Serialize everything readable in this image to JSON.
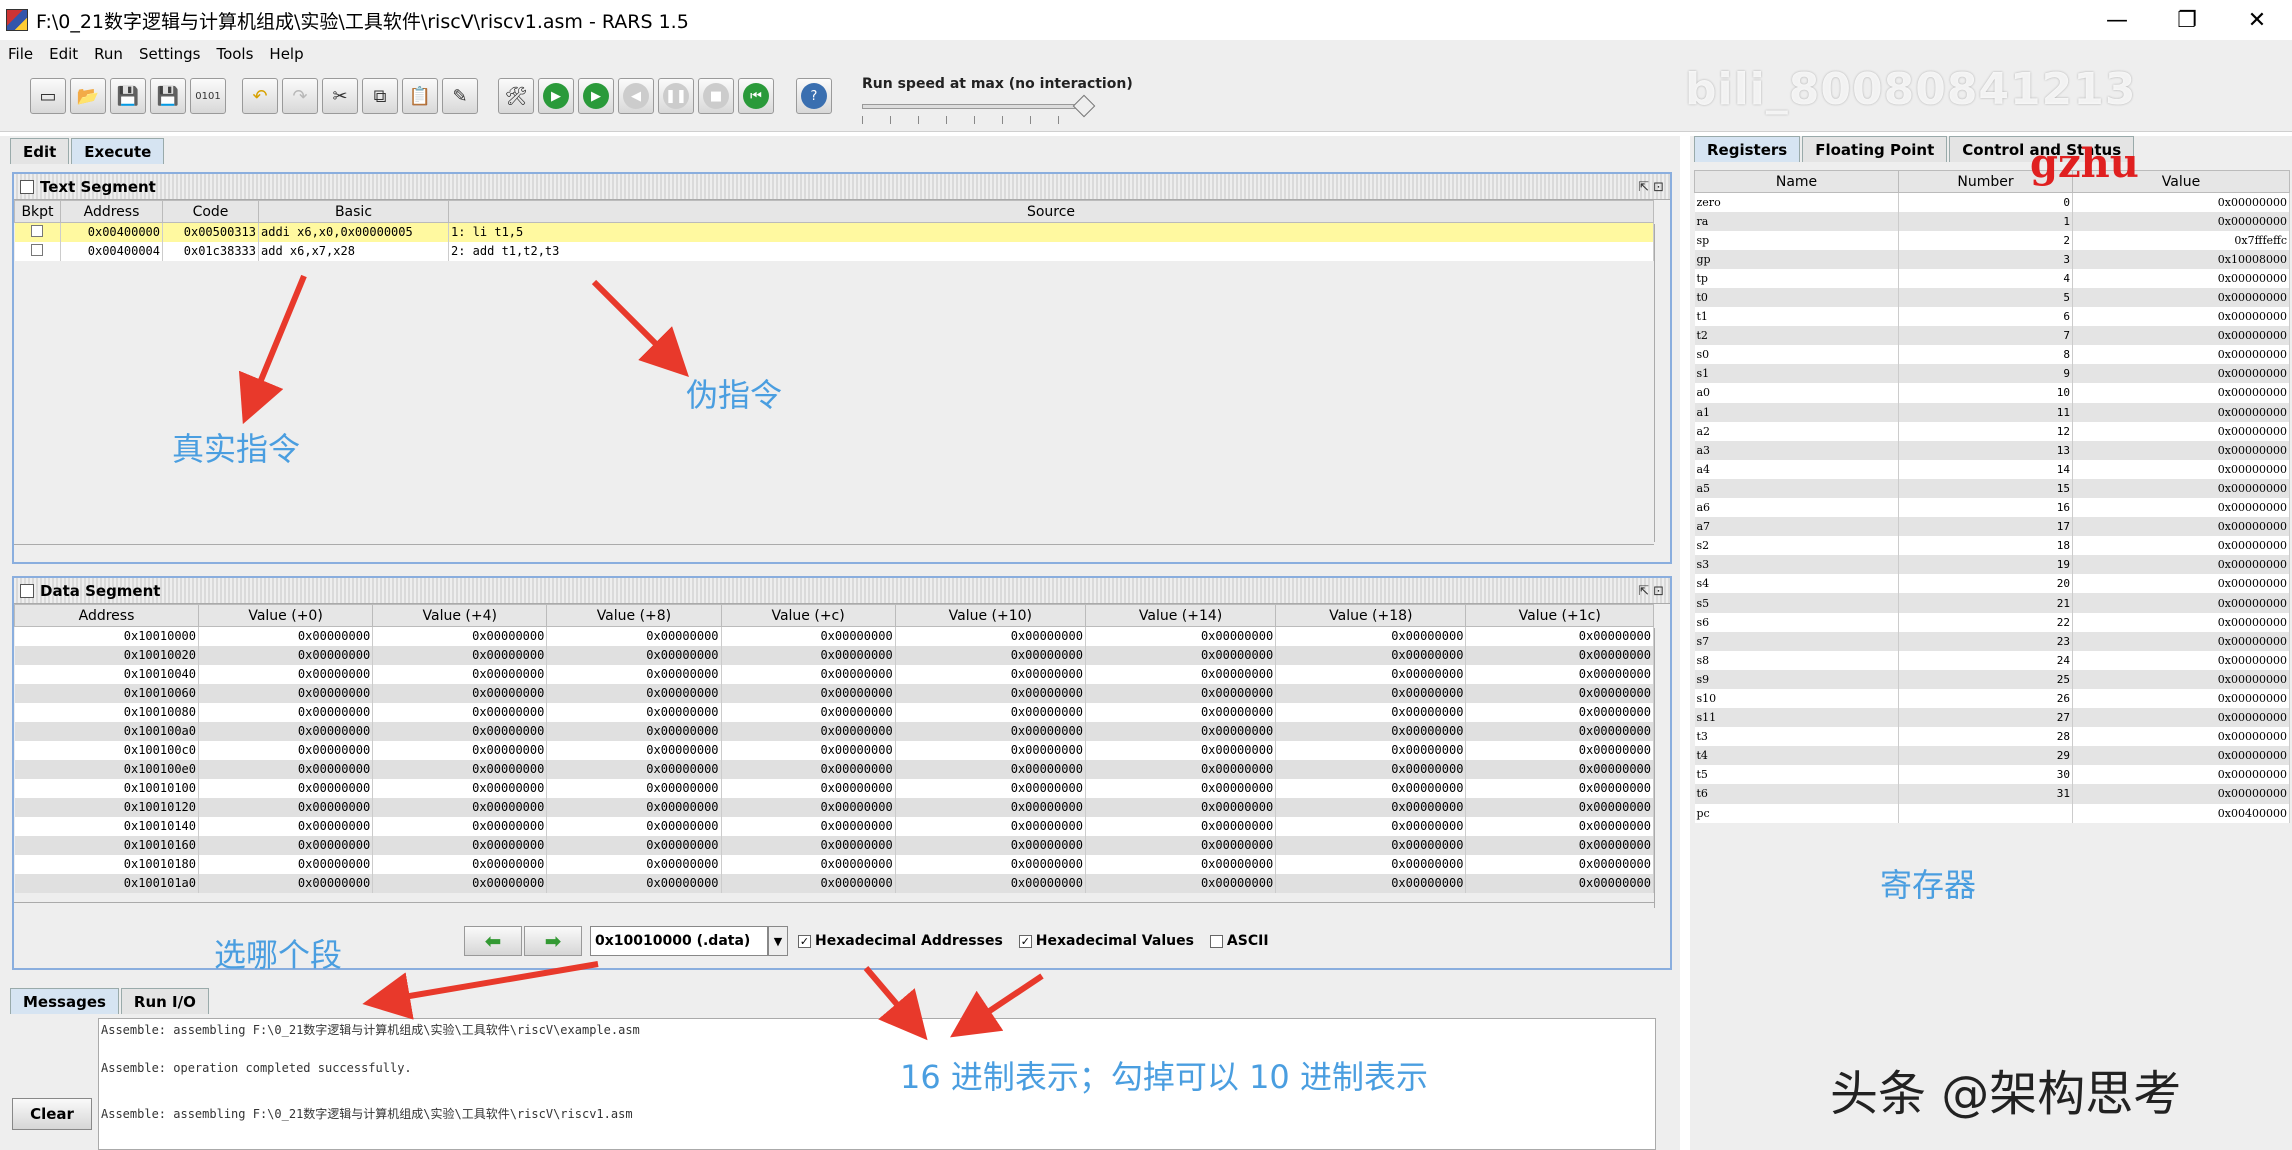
{
  "window": {
    "title": "F:\\0_21数字逻辑与计算机组成\\实验\\工具软件\\riscV\\riscv1.asm  - RARS 1.5",
    "minimize": "—",
    "maximize": "❐",
    "close": "✕"
  },
  "menu": [
    "File",
    "Edit",
    "Run",
    "Settings",
    "Tools",
    "Help"
  ],
  "toolbar": {
    "speed_label": "Run speed at max (no interaction)",
    "speed_level": "max"
  },
  "watermark": "bili_80080841213",
  "main_tabs": [
    "Edit",
    "Execute"
  ],
  "text_segment": {
    "title": "Text Segment",
    "columns": [
      "Bkpt",
      "Address",
      "Code",
      "Basic",
      "Source"
    ],
    "rows": [
      {
        "address": "0x00400000",
        "code": "0x00500313",
        "basic": "addi x6,x0,0x00000005",
        "source": "1:  li t1,5",
        "highlight": true
      },
      {
        "address": "0x00400004",
        "code": "0x01c38333",
        "basic": "add x6,x7,x28",
        "source": "2:  add t1,t2,t3",
        "highlight": false
      }
    ]
  },
  "data_segment": {
    "title": "Data Segment",
    "columns": [
      "Address",
      "Value (+0)",
      "Value (+4)",
      "Value (+8)",
      "Value (+c)",
      "Value (+10)",
      "Value (+14)",
      "Value (+18)",
      "Value (+1c)"
    ],
    "addresses": [
      "0x10010000",
      "0x10010020",
      "0x10010040",
      "0x10010060",
      "0x10010080",
      "0x100100a0",
      "0x100100c0",
      "0x100100e0",
      "0x10010100",
      "0x10010120",
      "0x10010140",
      "0x10010160",
      "0x10010180",
      "0x100101a0"
    ],
    "cell_value": "0x00000000",
    "segment_select": "0x10010000 (.data)",
    "hex_addresses_label": "Hexadecimal Addresses",
    "hex_values_label": "Hexadecimal Values",
    "ascii_label": "ASCII"
  },
  "bottom_tabs": [
    "Messages",
    "Run I/O"
  ],
  "messages": {
    "lines": [
      "Assemble: assembling F:\\0_21数字逻辑与计算机组成\\实验\\工具软件\\riscV\\example.asm",
      "Assemble: operation completed successfully.",
      "Assemble: assembling F:\\0_21数字逻辑与计算机组成\\实验\\工具软件\\riscV\\riscv1.asm"
    ],
    "clear_label": "Clear"
  },
  "register_tabs": [
    "Registers",
    "Floating Point",
    "Control and Status"
  ],
  "registers": {
    "columns": [
      "Name",
      "Number",
      "Value"
    ],
    "rows": [
      [
        "zero",
        "0",
        "0x00000000"
      ],
      [
        "ra",
        "1",
        "0x00000000"
      ],
      [
        "sp",
        "2",
        "0x7fffeffc"
      ],
      [
        "gp",
        "3",
        "0x10008000"
      ],
      [
        "tp",
        "4",
        "0x00000000"
      ],
      [
        "t0",
        "5",
        "0x00000000"
      ],
      [
        "t1",
        "6",
        "0x00000000"
      ],
      [
        "t2",
        "7",
        "0x00000000"
      ],
      [
        "s0",
        "8",
        "0x00000000"
      ],
      [
        "s1",
        "9",
        "0x00000000"
      ],
      [
        "a0",
        "10",
        "0x00000000"
      ],
      [
        "a1",
        "11",
        "0x00000000"
      ],
      [
        "a2",
        "12",
        "0x00000000"
      ],
      [
        "a3",
        "13",
        "0x00000000"
      ],
      [
        "a4",
        "14",
        "0x00000000"
      ],
      [
        "a5",
        "15",
        "0x00000000"
      ],
      [
        "a6",
        "16",
        "0x00000000"
      ],
      [
        "a7",
        "17",
        "0x00000000"
      ],
      [
        "s2",
        "18",
        "0x00000000"
      ],
      [
        "s3",
        "19",
        "0x00000000"
      ],
      [
        "s4",
        "20",
        "0x00000000"
      ],
      [
        "s5",
        "21",
        "0x00000000"
      ],
      [
        "s6",
        "22",
        "0x00000000"
      ],
      [
        "s7",
        "23",
        "0x00000000"
      ],
      [
        "s8",
        "24",
        "0x00000000"
      ],
      [
        "s9",
        "25",
        "0x00000000"
      ],
      [
        "s10",
        "26",
        "0x00000000"
      ],
      [
        "s11",
        "27",
        "0x00000000"
      ],
      [
        "t3",
        "28",
        "0x00000000"
      ],
      [
        "t4",
        "29",
        "0x00000000"
      ],
      [
        "t5",
        "30",
        "0x00000000"
      ],
      [
        "t6",
        "31",
        "0x00000000"
      ],
      [
        "pc",
        "",
        "0x00400000"
      ]
    ]
  },
  "annotations": {
    "real_instruction": "真实指令",
    "pseudo_instruction": "伪指令",
    "registers": "寄存器",
    "choose_segment": "选哪个段",
    "hex_display": "16 进制表示；勾掉可以 10 进制表示",
    "gzhu": "gzhu",
    "toutiao": "头条 @架构思考"
  },
  "colors": {
    "highlight_row": "#fff9a0",
    "annotation_blue": "#4a9ee0",
    "arrow_red": "#e8392b",
    "frame_border": "#8aaede"
  }
}
